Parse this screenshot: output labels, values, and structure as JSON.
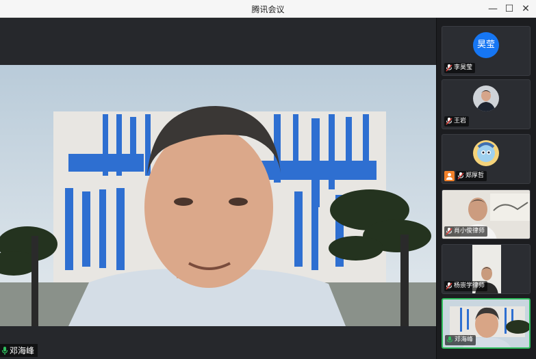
{
  "window": {
    "title": "腾讯会议",
    "minimize_glyph": "—",
    "maximize_glyph": "☐",
    "close_glyph": "✕"
  },
  "main_speaker": {
    "name": "邓海峰",
    "mic_icon": "mic-icon",
    "mic_color": "#2fbf5e"
  },
  "participants": [
    {
      "name": "李昊莹",
      "avatar_text": "昊莹",
      "avatar_color": "#1676f3",
      "muted": true
    },
    {
      "name": "王岩",
      "muted": true
    },
    {
      "name": "郑厚哲",
      "muted": true,
      "shares": true
    },
    {
      "name": "肖小俊律师",
      "muted": true
    },
    {
      "name": "杨崇学律师",
      "muted": true
    },
    {
      "name": "邓海峰",
      "muted": false,
      "active": true
    }
  ]
}
